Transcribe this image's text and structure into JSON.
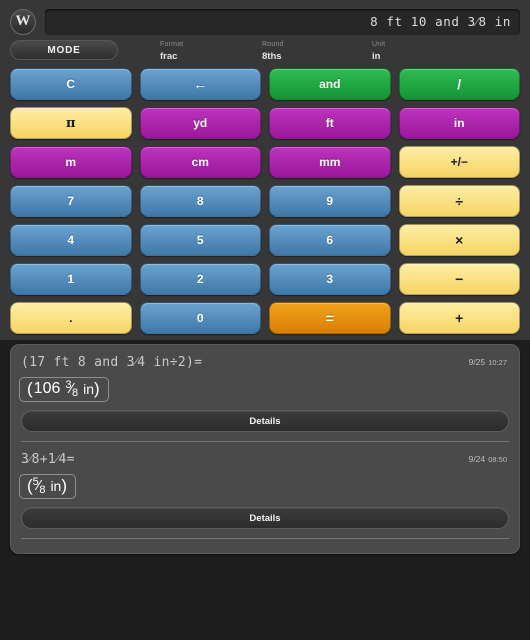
{
  "app": {
    "logo_text": "W",
    "background": "#1d1d1d",
    "panel_color": "#373737"
  },
  "display": {
    "value": "8 ft 10 and 3⁄8 in"
  },
  "mode_bar": {
    "mode_button_label": "MODE",
    "fields": [
      {
        "label": "Format",
        "value": "frac"
      },
      {
        "label": "Round",
        "value": "8ths"
      },
      {
        "label": "Unit",
        "value": "in"
      }
    ]
  },
  "keypad": {
    "rows": [
      [
        {
          "label": "C",
          "style": "blue",
          "name": "clear"
        },
        {
          "label": "←",
          "style": "blue",
          "name": "backspace"
        },
        {
          "label": "and",
          "style": "green",
          "name": "and"
        },
        {
          "label": "/",
          "style": "green",
          "name": "slash"
        }
      ],
      [
        {
          "label": "π",
          "style": "yellow",
          "name": "pi"
        },
        {
          "label": "yd",
          "style": "magenta",
          "name": "yard"
        },
        {
          "label": "ft",
          "style": "magenta",
          "name": "feet"
        },
        {
          "label": "in",
          "style": "magenta",
          "name": "inch"
        }
      ],
      [
        {
          "label": "m",
          "style": "magenta",
          "name": "meter"
        },
        {
          "label": "cm",
          "style": "magenta",
          "name": "centimeter"
        },
        {
          "label": "mm",
          "style": "magenta",
          "name": "millimeter"
        },
        {
          "label": "+/−",
          "style": "yellow",
          "name": "sign-toggle"
        }
      ],
      [
        {
          "label": "7",
          "style": "blue",
          "name": "digit-7"
        },
        {
          "label": "8",
          "style": "blue",
          "name": "digit-8"
        },
        {
          "label": "9",
          "style": "blue",
          "name": "digit-9"
        },
        {
          "label": "÷",
          "style": "yellow",
          "name": "divide"
        }
      ],
      [
        {
          "label": "4",
          "style": "blue",
          "name": "digit-4"
        },
        {
          "label": "5",
          "style": "blue",
          "name": "digit-5"
        },
        {
          "label": "6",
          "style": "blue",
          "name": "digit-6"
        },
        {
          "label": "×",
          "style": "yellow",
          "name": "multiply"
        }
      ],
      [
        {
          "label": "1",
          "style": "blue",
          "name": "digit-1"
        },
        {
          "label": "2",
          "style": "blue",
          "name": "digit-2"
        },
        {
          "label": "3",
          "style": "blue",
          "name": "digit-3"
        },
        {
          "label": "−",
          "style": "yellow",
          "name": "subtract"
        }
      ],
      [
        {
          "label": ".",
          "style": "yellow",
          "name": "decimal-point"
        },
        {
          "label": "0",
          "style": "blue",
          "name": "digit-0"
        },
        {
          "label": "=",
          "style": "orange",
          "name": "equals"
        },
        {
          "label": "+",
          "style": "yellow",
          "name": "add"
        }
      ]
    ]
  },
  "history": {
    "details_label": "Details",
    "entries": [
      {
        "expression": "(17 ft 8 and 3⁄4 in÷2)=",
        "date": "9/25",
        "time": "10:27",
        "result": {
          "open": "(",
          "whole": "106",
          "numerator": "3",
          "bar": "⁄",
          "denominator": "8",
          "unit": "in",
          "close": ")"
        }
      },
      {
        "expression": "3⁄8+1⁄4=",
        "date": "9/24",
        "time": "08:50",
        "result": {
          "open": "(",
          "whole": "",
          "numerator": "5",
          "bar": "⁄",
          "denominator": "8",
          "unit": "in",
          "close": ")"
        }
      }
    ]
  },
  "colors": {
    "blue": "#4d86b8",
    "green": "#1ea63f",
    "magenta": "#a924a9",
    "yellow": "#fbe288",
    "orange": "#e4890f"
  }
}
